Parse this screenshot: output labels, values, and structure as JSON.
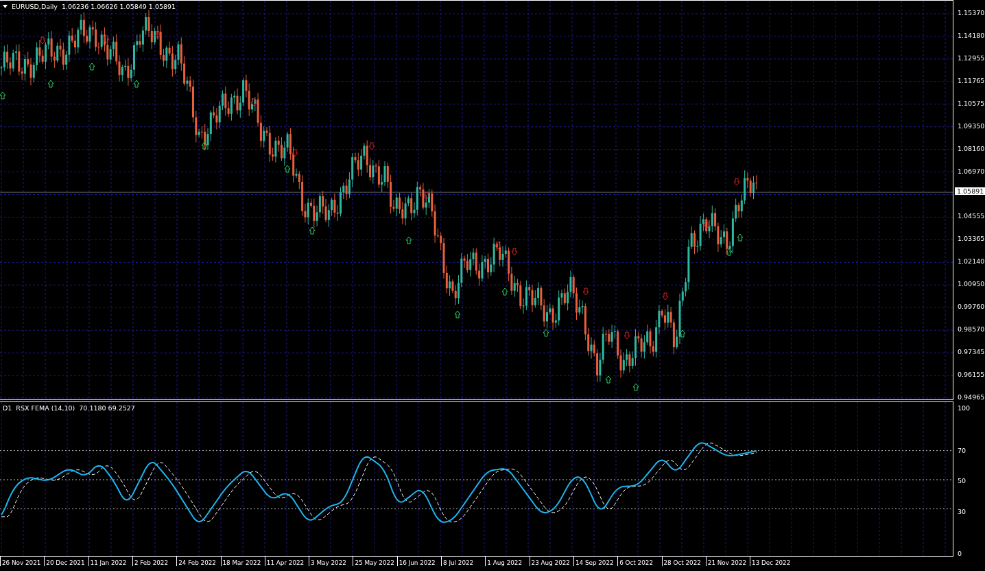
{
  "chart": {
    "title": "EURUSD,Daily",
    "ohlc": [
      "1.06236",
      "1.06626",
      "1.05849",
      "1.05891"
    ],
    "price_axis": {
      "labels": [
        "1.15370",
        "1.14180",
        "1.12955",
        "1.11765",
        "1.10575",
        "1.09350",
        "1.08160",
        "1.06970",
        "1.04555",
        "1.03365",
        "1.02140",
        "1.00950",
        "0.99760",
        "0.98570",
        "0.97345",
        "0.96155",
        "0.94965"
      ],
      "current_price": "1.05891"
    }
  },
  "indicator": {
    "period": "D1",
    "title": "RSX FEMA (14,10)",
    "values": [
      "70.1180",
      "69.2527"
    ],
    "axis_labels": [
      "100",
      "70",
      "50",
      "30",
      "0"
    ]
  },
  "time_axis": {
    "labels": [
      "26 Nov 2021",
      "20 Dec 2021",
      "11 Jan 2022",
      "2 Feb 2022",
      "24 Feb 2022",
      "18 Mar 2022",
      "11 Apr 2022",
      "3 May 2022",
      "25 May 2022",
      "16 Jun 2022",
      "8 Jul 2022",
      "1 Aug 2022",
      "23 Aug 2022",
      "14 Sep 2022",
      "6 Oct 2022",
      "28 Oct 2022",
      "21 Nov 2022",
      "13 Dec 2022"
    ]
  }
}
